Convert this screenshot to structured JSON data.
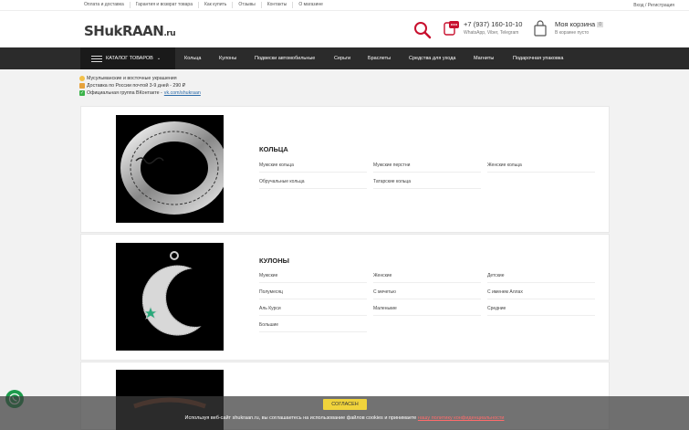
{
  "topbar": {
    "links": [
      "Оплата и доставка",
      "Гарантия и возврат товара",
      "Как купить",
      "Отзывы",
      "Контакты",
      "О магазине"
    ],
    "login": "Вход / Регистрация"
  },
  "header": {
    "logo_main": "SHukRAAN",
    "logo_suffix": ".ru",
    "phone": "+7 (937) 160-10-10",
    "phone_sub": "WhatsApp, Viber, Telegram",
    "cart_title": "Моя корзина",
    "cart_count": "0",
    "cart_status": "В корзине пусто"
  },
  "nav": {
    "catalog_label": "КАТАЛОГ ТОВАРОВ",
    "items": [
      "Кольца",
      "Кулоны",
      "Подвески автомобильные",
      "Серьги",
      "Браслеты",
      "Средства для ухода",
      "Магниты",
      "Подарочная упаковка"
    ]
  },
  "info": {
    "line1": "Мусульманские и восточные украшения",
    "line2": "Доставка по России почтой 3-9 дней - 290 ₽",
    "line3": "Официальная группа ВКонтакте -",
    "line3_link": "vk.com/shukraan"
  },
  "categories": [
    {
      "title": "КОЛЬЦА",
      "subs": [
        "Мужские кольца",
        "Мужские перстни",
        "Женские кольца",
        "Обручальные кольца",
        "Татарские кольца"
      ]
    },
    {
      "title": "КУЛОНЫ",
      "subs": [
        "Мужские",
        "Женские",
        "Детские",
        "Полумесяц",
        "С мечетью",
        "С именем Аллах",
        "Аль Курси",
        "Маленькие",
        "Средние",
        "Большие"
      ]
    }
  ],
  "cookie": {
    "accept": "СОГЛАСЕН",
    "message": "Используя веб-сайт shukraan.ru, вы соглашаетесь на использование файлов cookies и принимаете",
    "link": "нашу политику конфиденциальности"
  },
  "colors": {
    "nav_bg": "#2b2b2b",
    "accent_red": "#c8102e",
    "cookie_button": "#f0d33b"
  }
}
